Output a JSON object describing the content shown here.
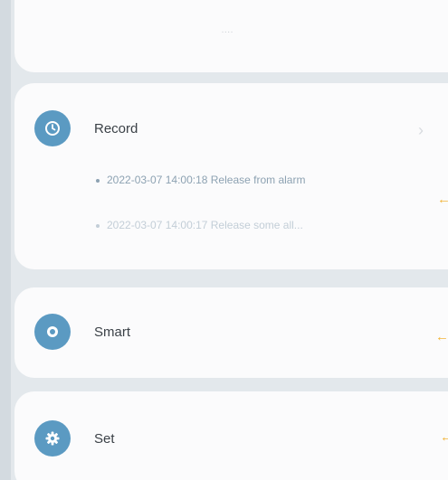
{
  "top_card": {
    "hint": "····"
  },
  "record": {
    "title": "Record",
    "icon": "clock-icon",
    "items": [
      "2022-03-07 14:00:18 Release from alarm",
      "2022-03-07 14:00:17 Release some all..."
    ]
  },
  "smart": {
    "title": "Smart",
    "icon": "smart-toggle-icon"
  },
  "set": {
    "title": "Set",
    "icon": "gear-icon"
  },
  "colors": {
    "accent": "#5b9ac2",
    "annotation": "#f2b53a",
    "background": "#e3e8ec"
  }
}
